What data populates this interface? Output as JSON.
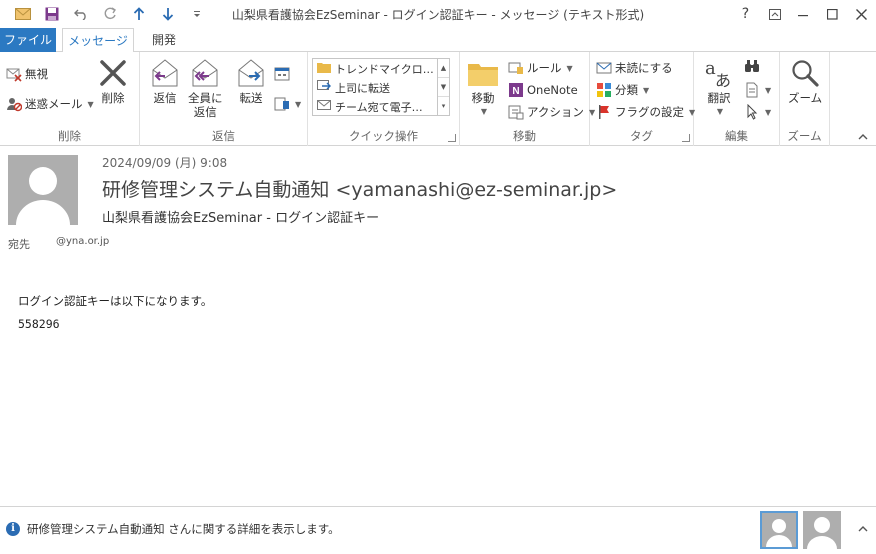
{
  "window": {
    "title": "山梨県看護協会EzSeminar - ログイン認証キー - メッセージ (テキスト形式)",
    "help": "?",
    "restore_ribbon": "⊡",
    "minimize": "—",
    "maximize": "□",
    "close": "✕"
  },
  "tabs": {
    "file": "ファイル",
    "message": "メッセージ",
    "developer": "開発"
  },
  "ribbon": {
    "delete_group": {
      "ignore": "無視",
      "junk": "迷惑メール",
      "delete": "削除",
      "label": "削除"
    },
    "respond_group": {
      "reply": "返信",
      "reply_all_line1": "全員に",
      "reply_all_line2": "返信",
      "forward": "転送",
      "label": "返信"
    },
    "quicksteps_group": {
      "items": [
        "トレンドマイクロ…",
        "上司に転送",
        "チーム宛て電子…"
      ],
      "label": "クイック操作"
    },
    "move_group": {
      "move": "移動",
      "rules": "ルール",
      "onenote": "OneNote",
      "actions": "アクション",
      "label": "移動"
    },
    "tags_group": {
      "unread": "未読にする",
      "categorize": "分類",
      "followup": "フラグの設定",
      "label": "タグ"
    },
    "editing_group": {
      "translate": "翻訳",
      "label": "編集"
    },
    "zoom_group": {
      "zoom": "ズーム",
      "label": "ズーム"
    }
  },
  "message": {
    "date": "2024/09/09 (月) 9:08",
    "from": "研修管理システム自動通知 <yamanashi@ez-seminar.jp>",
    "subject": "山梨県看護協会EzSeminar - ログイン認証キー",
    "to_label": "宛先",
    "to_value": "@yna.or.jp",
    "body_line1": "ログイン認証キーは以下になります。",
    "body_line2": "558296"
  },
  "people_pane": {
    "info_text": "研修管理システム自動通知 さんに関する詳細を表示します。"
  },
  "colors": {
    "accent": "#2b79c2",
    "avatar": "#aeaeae"
  }
}
